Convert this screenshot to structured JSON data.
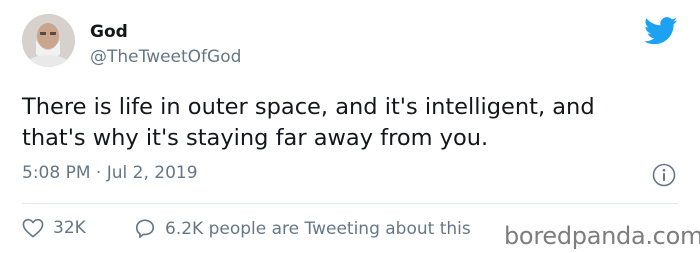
{
  "author": {
    "name": "God",
    "handle": "@TheTweetOfGod"
  },
  "tweet": {
    "text": "There is life in outer space, and it's intelligent, and\nthat's why it's staying far away from you.",
    "timestamp": "5:08 PM · Jul 2, 2019"
  },
  "stats": {
    "likes": "32K",
    "talk": "6.2K people are Tweeting about this"
  },
  "watermark": "boredpanda.com",
  "colors": {
    "twitter_blue": "#1da1f2",
    "muted": "#657786",
    "text": "#14171a"
  },
  "icons": [
    "twitter-bird-icon",
    "info-icon",
    "heart-icon",
    "speech-bubble-icon"
  ]
}
